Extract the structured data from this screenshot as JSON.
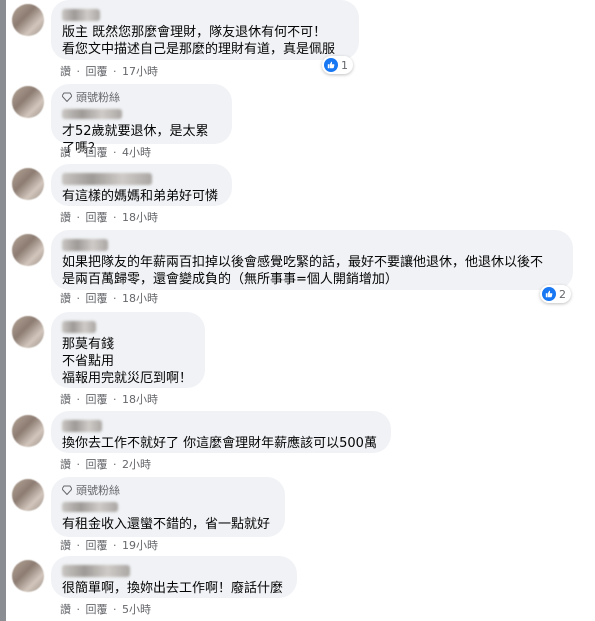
{
  "comments": [
    {
      "text": "版主 既然您那麼會理財，隊友退休有何不可！\n看您文中描述自己是那麼的理財有道，真是佩服",
      "badge": "",
      "meta": [
        "讚",
        "回覆",
        "17小時"
      ],
      "reactions": "1"
    },
    {
      "text": "才52歲就要退休，是太累了嗎？",
      "badge": "頭號粉絲",
      "meta": [
        "讚",
        "回覆",
        "4小時"
      ],
      "reactions": ""
    },
    {
      "text": "有這樣的媽媽和弟弟好可憐",
      "badge": "",
      "meta": [
        "讚",
        "回覆",
        "18小時"
      ],
      "reactions": ""
    },
    {
      "text": "如果把隊友的年薪兩百扣掉以後會感覺吃緊的話，最好不要讓他退休，他退休以後不\n是兩百萬歸零，還會變成負的（無所事事=個人開銷增加）",
      "badge": "",
      "meta": [
        "讚",
        "回覆",
        "18小時"
      ],
      "reactions": "2"
    },
    {
      "text": "那莫有錢\n不省點用\n福報用完就災厄到啊！",
      "badge": "",
      "meta": [
        "讚",
        "回覆",
        "18小時"
      ],
      "reactions": ""
    },
    {
      "text": "換你去工作不就好了 你這麼會理財年薪應該可以500萬",
      "badge": "",
      "meta": [
        "讚",
        "回覆",
        "2小時"
      ],
      "reactions": ""
    },
    {
      "text": "有租金收入還蠻不錯的，省一點就好",
      "badge": "頭號粉絲",
      "meta": [
        "讚",
        "回覆",
        "19小時"
      ],
      "reactions": ""
    },
    {
      "text": "很簡單啊，換妳出去工作啊！廢話什麼",
      "badge": "",
      "meta": [
        "讚",
        "回覆",
        "5小時"
      ],
      "reactions": ""
    }
  ],
  "separator": "·",
  "icons": {
    "like": "thumbs-up-icon",
    "badge": "diamond-icon"
  },
  "colors": {
    "bubble": "#f0f2f5",
    "meta": "#65676b",
    "like": "#1877f2"
  }
}
